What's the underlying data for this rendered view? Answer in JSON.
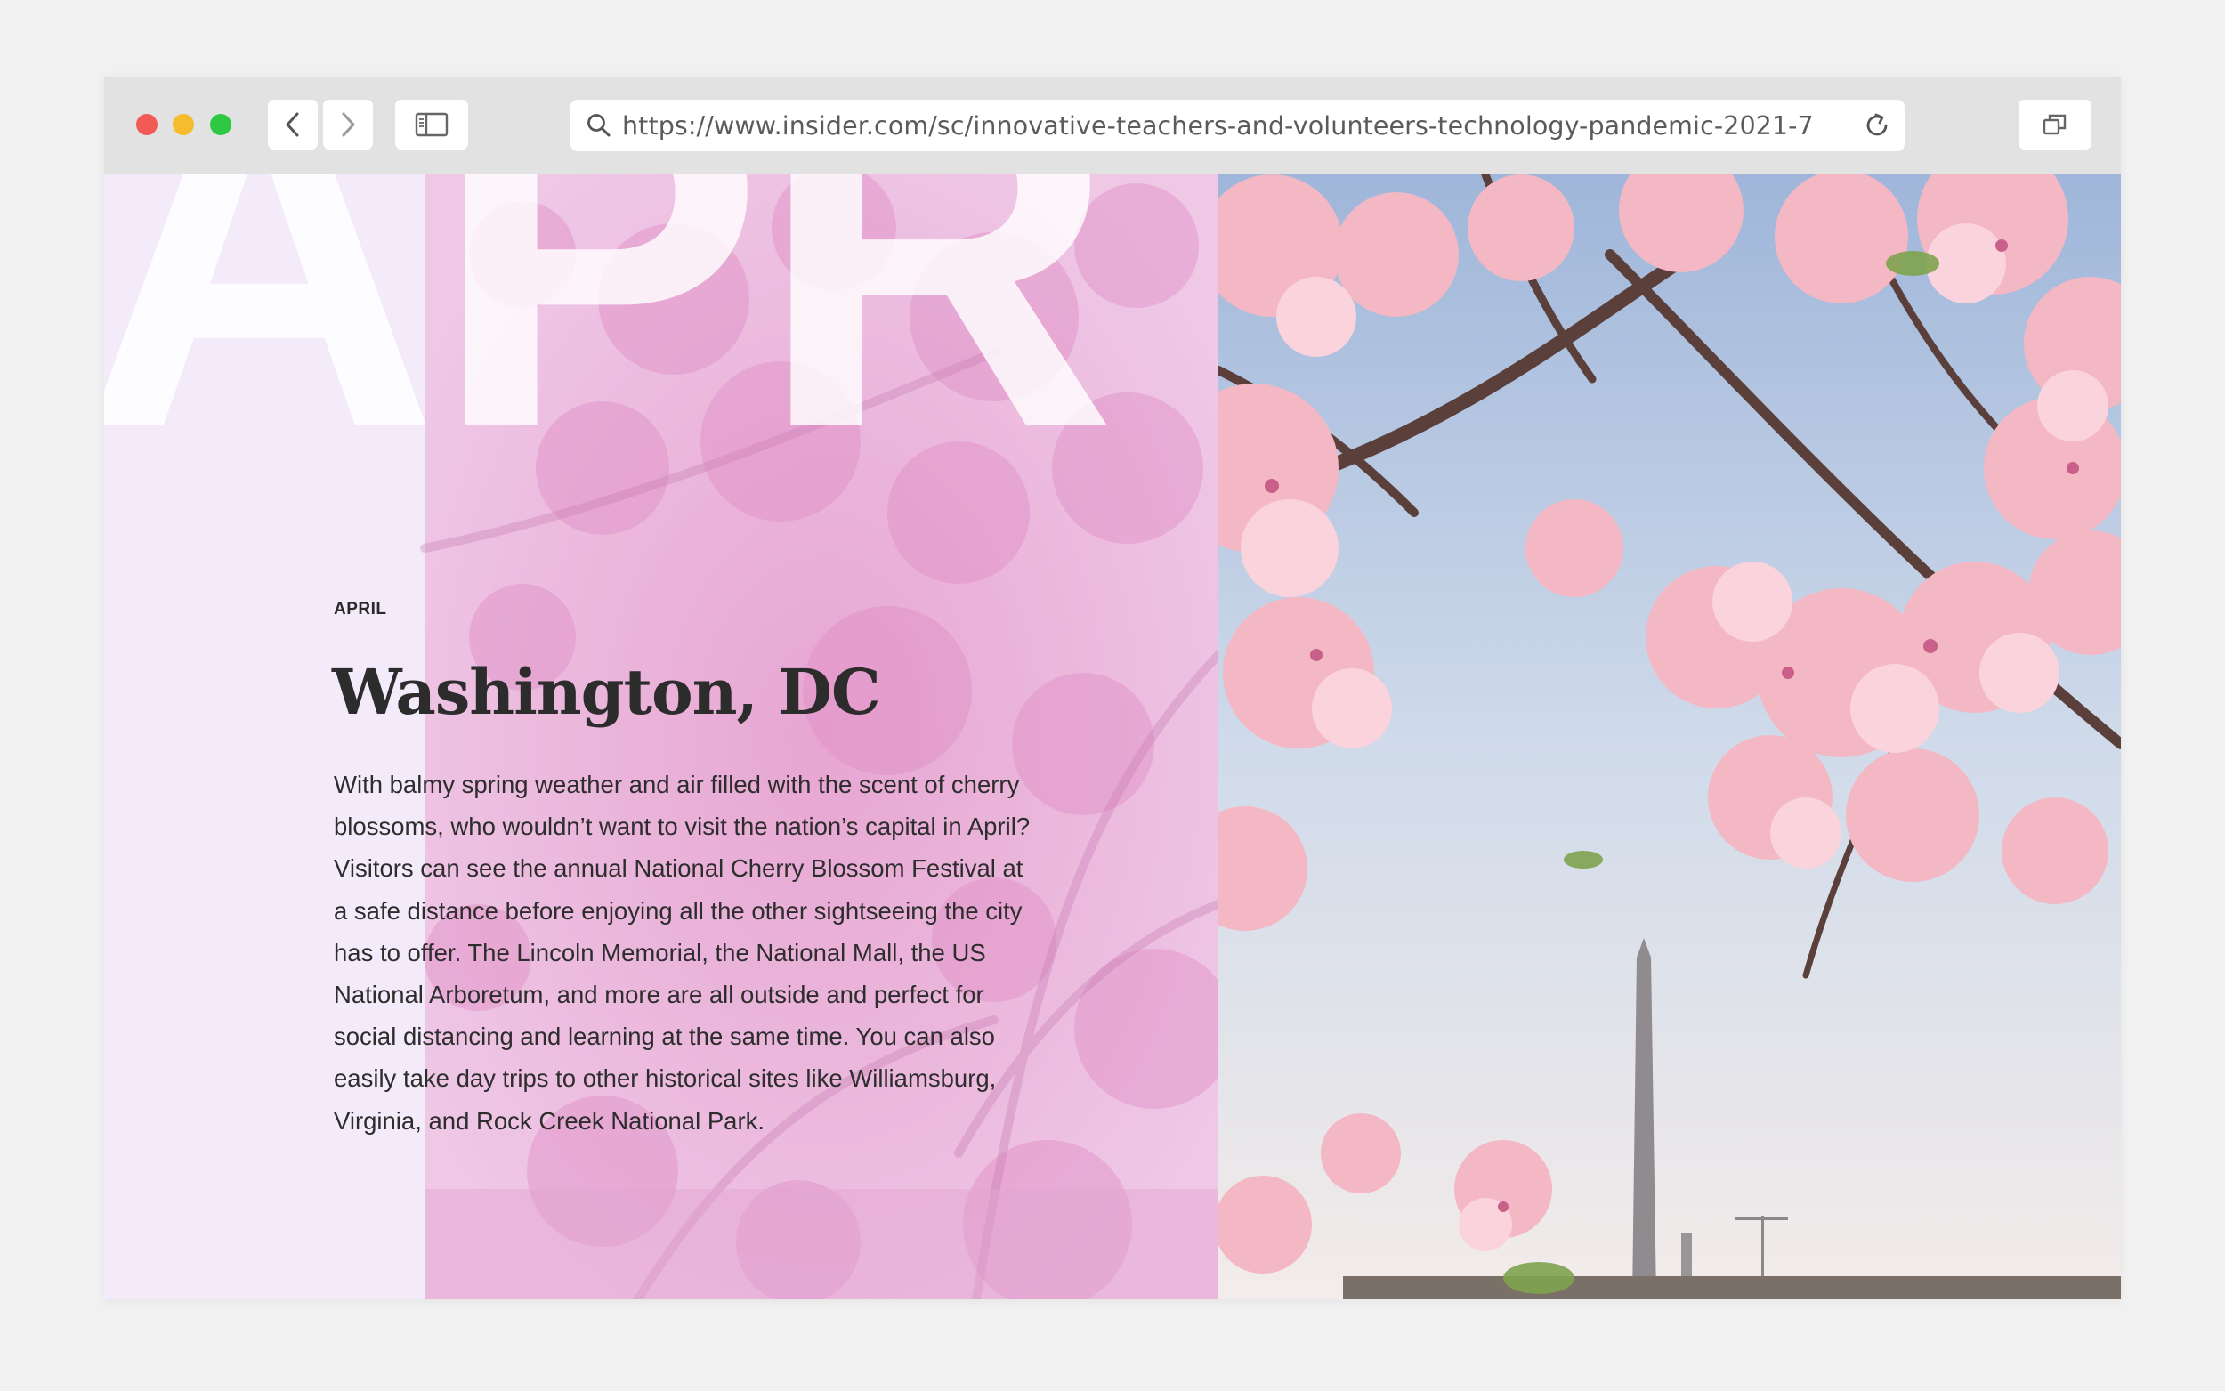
{
  "browser": {
    "url": "https://www.insider.com/sc/innovative-teachers-and-volunteers-technology-pandemic-2021-7",
    "icons": {
      "back": "chevron-left-icon",
      "forward": "chevron-right-icon",
      "sidebar": "sidebar-icon",
      "search": "search-icon",
      "reload": "reload-icon",
      "tabs": "tabs-icon"
    },
    "traffic_light_colors": {
      "close": "#f25b55",
      "minimize": "#f7bb2e",
      "maximize": "#2fc842"
    }
  },
  "article": {
    "big_month": "APR",
    "kicker": "APRIL",
    "title": "Washington, DC",
    "body": "With balmy spring weather and air filled with the scent of cherry blossoms, who wouldn’t want to visit the nation’s capital in April? Visitors can see the annual National Cherry Blossom Festival at a safe distance before enjoying all the other sightseeing the city has to offer. The Lincoln Memorial, the National Mall, the US National Arboretum, and more are all outside and perfect for social distancing and learning at the same time. You can also easily take day trips to other historical sites like Williamsburg, Virginia, and Rock Creek National Park."
  },
  "colors": {
    "left_panel_bg": "#f3ebfa",
    "blossom_pink": "#f2b9c8",
    "sky": "#c9d8ec"
  }
}
